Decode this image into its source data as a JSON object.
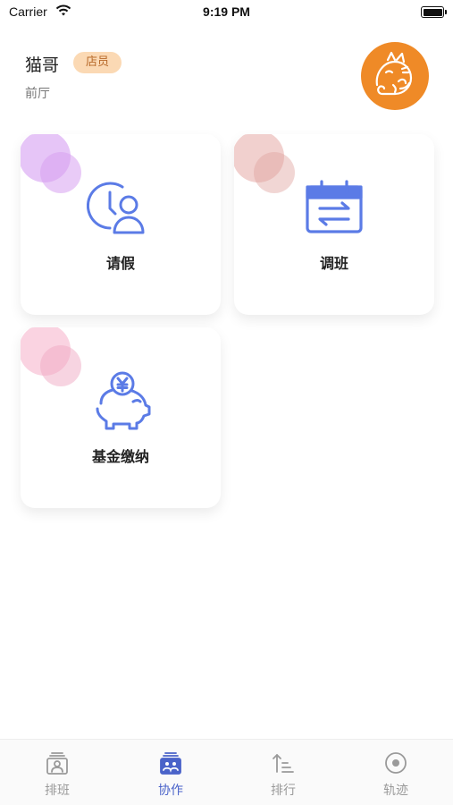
{
  "status_bar": {
    "carrier": "Carrier",
    "time": "9:19 PM"
  },
  "profile": {
    "name": "猫哥",
    "role": "店员",
    "department": "前厅",
    "avatar_icon": "cat-avatar-icon"
  },
  "cards": [
    {
      "label": "请假",
      "icon": "leave-clock-person-icon"
    },
    {
      "label": "调班",
      "icon": "calendar-swap-icon"
    },
    {
      "label": "基金缴纳",
      "icon": "piggy-bank-yen-icon"
    }
  ],
  "tab_bar": {
    "tabs": [
      {
        "label": "排班",
        "icon": "schedule-icon",
        "active": false
      },
      {
        "label": "协作",
        "icon": "collab-icon",
        "active": true
      },
      {
        "label": "排行",
        "icon": "rank-icon",
        "active": false
      },
      {
        "label": "轨迹",
        "icon": "track-icon",
        "active": false
      }
    ]
  },
  "colors": {
    "accent": "#4a63c9",
    "icon_blue": "#5b7be6",
    "badge_bg": "#fbd9b4",
    "badge_text": "#b86a2a",
    "avatar_bg": "#ef8a27"
  }
}
